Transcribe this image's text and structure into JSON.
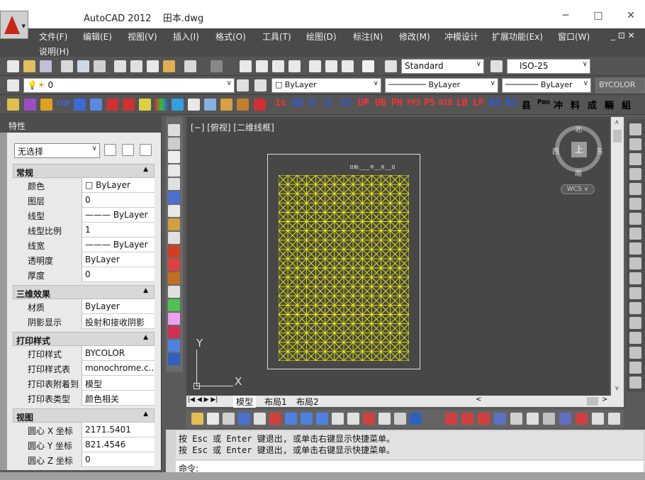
{
  "app": {
    "title": "AutoCAD 2012",
    "filename": "田本.dwg",
    "logo_icon": "autocad-a-icon"
  },
  "window_controls": {
    "minimize": "─",
    "maximize": "□",
    "close": "✕"
  },
  "menu": {
    "row1": [
      "文件(F)",
      "编辑(E)",
      "视图(V)",
      "插入(I)",
      "格式(O)",
      "工具(T)",
      "绘图(D)",
      "标注(N)",
      "修改(M)",
      "冲模设计",
      "扩展功能(Ex)",
      "窗口(W)"
    ],
    "row2": [
      "说明(H)"
    ],
    "doc_controls": "_ ⊡ ✕"
  },
  "toolbar1": {
    "textstyle": "Standard",
    "dimstyle": "ISO-25"
  },
  "toolbar2": {
    "layer": "0",
    "color": "ByLayer",
    "linetype": "ByLayer",
    "lineweight": "ByLayer",
    "plotstyle": "BYCOLOR"
  },
  "toolbar3_labels": [
    "1s",
    "HD",
    "U",
    "U",
    "CV",
    "UP",
    "UB",
    "PH",
    "PPS",
    "P5",
    "DIE",
    "LB",
    "LP",
    "B2",
    "BJ",
    "县",
    "Pmo",
    "冲",
    "料",
    "成",
    "輛",
    "組"
  ],
  "properties": {
    "title": "特性",
    "selection": "无选择",
    "sections": [
      {
        "name": "常规",
        "rows": [
          [
            "颜色",
            "□ ByLayer"
          ],
          [
            "图层",
            "0"
          ],
          [
            "线型",
            "——— ByLayer"
          ],
          [
            "线型比例",
            "1"
          ],
          [
            "线宽",
            "——— ByLayer"
          ],
          [
            "透明度",
            "ByLayer"
          ],
          [
            "厚度",
            "0"
          ]
        ]
      },
      {
        "name": "三维效果",
        "rows": [
          [
            "材质",
            "ByLayer"
          ],
          [
            "阴影显示",
            "投射和接收阴影"
          ]
        ]
      },
      {
        "name": "打印样式",
        "rows": [
          [
            "打印样式",
            "BYCOLOR"
          ],
          [
            "打印样式表",
            "monochrome.c..."
          ],
          [
            "打印表附着到",
            "模型"
          ],
          [
            "打印表类型",
            "颜色相关"
          ]
        ]
      },
      {
        "name": "视图",
        "rows": [
          [
            "圆心 X 坐标",
            "2171.5401"
          ],
          [
            "圆心 Y 坐标",
            "821.4546"
          ],
          [
            "圆心 Z 坐标",
            "0"
          ]
        ]
      }
    ]
  },
  "viewport": {
    "label": "[−] [俯视] [二维线框]",
    "paper_header": "日期:_____年___月___日",
    "grid_rows": 20,
    "grid_cols": 14,
    "grid_color": "#f0f000"
  },
  "viewcube": {
    "north": "北",
    "south": "南",
    "east": "东",
    "west": "西",
    "top": "上",
    "wcs": "WCS"
  },
  "ucs": {
    "y": "Y",
    "x": "X"
  },
  "tabs": [
    "模型",
    "布局1",
    "布局2"
  ],
  "command": {
    "history": [
      "按 Esc 或 Enter 键退出, 或单击右键显示快捷菜单。",
      "按 Esc 或 Enter 键退出, 或单击右键显示快捷菜单。"
    ],
    "prompt": "命令:"
  }
}
